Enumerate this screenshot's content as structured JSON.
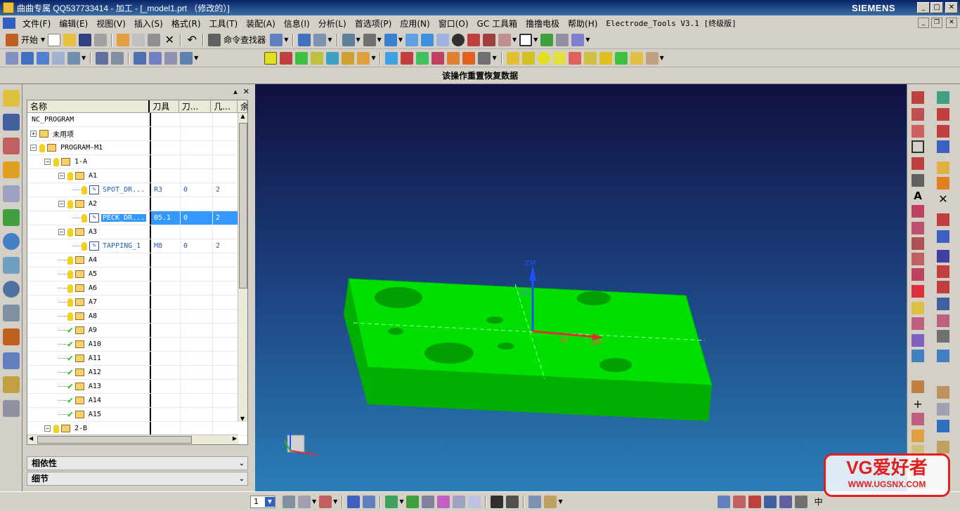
{
  "window": {
    "title": "曲曲专属 QQ537733414 - 加工 - [_model1.prt （修改的）]",
    "brand": "SIEMENS"
  },
  "menu": [
    "文件(F)",
    "编辑(E)",
    "视图(V)",
    "插入(S)",
    "格式(R)",
    "工具(T)",
    "装配(A)",
    "信息(I)",
    "分析(L)",
    "首选项(P)",
    "应用(N)",
    "窗口(O)",
    "GC 工具箱",
    "撸撸电极",
    "帮助(H)",
    "Electrode_Tools V3.1 [终级版]"
  ],
  "toolbar": {
    "start_label": "开始",
    "command_finder_label": "命令查找器"
  },
  "status_message": "该操作重置恢复数据",
  "navigator": {
    "columns": [
      "名称",
      "刀具",
      "刀...",
      "几...",
      "余"
    ],
    "rows": [
      {
        "indent": 0,
        "expander": "",
        "status": "",
        "icon": "",
        "name": "NC_PROGRAM",
        "tool": "",
        "c2": "",
        "c3": "",
        "selected": false
      },
      {
        "indent": 0,
        "expander": "+",
        "status": "",
        "icon": "folder",
        "name": "未用项",
        "tool": "",
        "c2": "",
        "c3": "",
        "selected": false
      },
      {
        "indent": 0,
        "expander": "-",
        "status": "bulb",
        "icon": "folder",
        "name": "PROGRAM-M1",
        "tool": "",
        "c2": "",
        "c3": "",
        "selected": false
      },
      {
        "indent": 1,
        "expander": "-",
        "status": "bulb",
        "icon": "folder",
        "name": "1-A",
        "tool": "",
        "c2": "",
        "c3": "",
        "selected": false
      },
      {
        "indent": 2,
        "expander": "-",
        "status": "bulb",
        "icon": "folder",
        "name": "A1",
        "tool": "",
        "c2": "",
        "c3": "",
        "selected": false
      },
      {
        "indent": 3,
        "expander": "",
        "status": "bulb",
        "icon": "op",
        "name": "SPOT_DR...",
        "tool": "R3",
        "c2": "0",
        "c3": "2",
        "selected": false
      },
      {
        "indent": 2,
        "expander": "-",
        "status": "bulb",
        "icon": "folder",
        "name": "A2",
        "tool": "",
        "c2": "",
        "c3": "",
        "selected": false
      },
      {
        "indent": 3,
        "expander": "",
        "status": "bulb",
        "icon": "op",
        "name": "PECK_DR...",
        "tool": "05.1",
        "c2": "0",
        "c3": "2",
        "selected": true
      },
      {
        "indent": 2,
        "expander": "-",
        "status": "bulb",
        "icon": "folder",
        "name": "A3",
        "tool": "",
        "c2": "",
        "c3": "",
        "selected": false
      },
      {
        "indent": 3,
        "expander": "",
        "status": "bulb",
        "icon": "op",
        "name": "TAPPING_1",
        "tool": "M8",
        "c2": "0",
        "c3": "2",
        "selected": false
      },
      {
        "indent": 2,
        "expander": "",
        "status": "bulb",
        "icon": "folder",
        "name": "A4",
        "tool": "",
        "c2": "",
        "c3": "",
        "selected": false
      },
      {
        "indent": 2,
        "expander": "",
        "status": "bulb",
        "icon": "folder",
        "name": "A5",
        "tool": "",
        "c2": "",
        "c3": "",
        "selected": false
      },
      {
        "indent": 2,
        "expander": "",
        "status": "bulb",
        "icon": "folder",
        "name": "A6",
        "tool": "",
        "c2": "",
        "c3": "",
        "selected": false
      },
      {
        "indent": 2,
        "expander": "",
        "status": "bulb",
        "icon": "folder",
        "name": "A7",
        "tool": "",
        "c2": "",
        "c3": "",
        "selected": false
      },
      {
        "indent": 2,
        "expander": "",
        "status": "bulb",
        "icon": "folder",
        "name": "A8",
        "tool": "",
        "c2": "",
        "c3": "",
        "selected": false
      },
      {
        "indent": 2,
        "expander": "",
        "status": "check",
        "icon": "folder",
        "name": "A9",
        "tool": "",
        "c2": "",
        "c3": "",
        "selected": false
      },
      {
        "indent": 2,
        "expander": "",
        "status": "check",
        "icon": "folder",
        "name": "A10",
        "tool": "",
        "c2": "",
        "c3": "",
        "selected": false
      },
      {
        "indent": 2,
        "expander": "",
        "status": "check",
        "icon": "folder",
        "name": "A11",
        "tool": "",
        "c2": "",
        "c3": "",
        "selected": false
      },
      {
        "indent": 2,
        "expander": "",
        "status": "check",
        "icon": "folder",
        "name": "A12",
        "tool": "",
        "c2": "",
        "c3": "",
        "selected": false
      },
      {
        "indent": 2,
        "expander": "",
        "status": "check",
        "icon": "folder",
        "name": "A13",
        "tool": "",
        "c2": "",
        "c3": "",
        "selected": false
      },
      {
        "indent": 2,
        "expander": "",
        "status": "check",
        "icon": "folder",
        "name": "A14",
        "tool": "",
        "c2": "",
        "c3": "",
        "selected": false
      },
      {
        "indent": 2,
        "expander": "",
        "status": "check",
        "icon": "folder",
        "name": "A15",
        "tool": "",
        "c2": "",
        "c3": "",
        "selected": false
      },
      {
        "indent": 1,
        "expander": "-",
        "status": "bulb",
        "icon": "folder",
        "name": "2-B",
        "tool": "",
        "c2": "",
        "c3": "",
        "selected": false
      }
    ],
    "sections": [
      "相依性",
      "细节"
    ]
  },
  "viewport": {
    "axis_labels": {
      "zm": "ZM",
      "zc": "ZC",
      "xc": "XC",
      "xm": "XM"
    },
    "part_color": "#00e000",
    "part_side_color": "#00b800"
  },
  "bottom": {
    "layer_value": "1",
    "work_label": "中"
  },
  "watermark": {
    "line1": "VG爱好者",
    "line2": "WWW.UGSNX.COM"
  }
}
